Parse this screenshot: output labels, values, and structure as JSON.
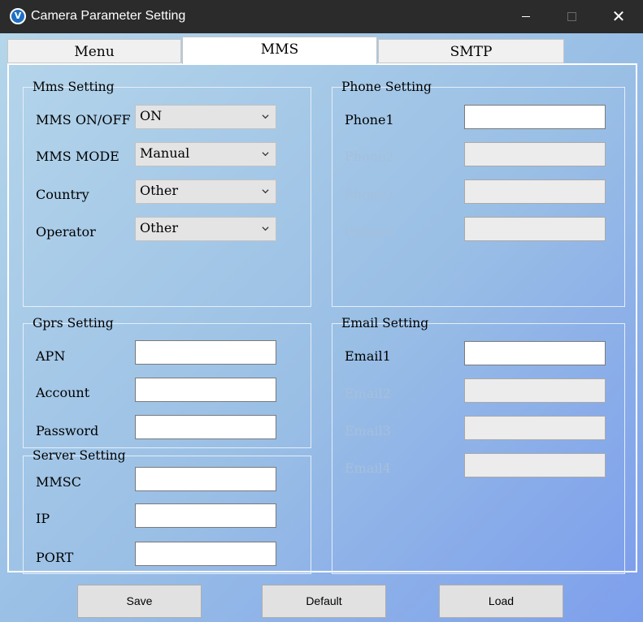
{
  "window": {
    "title": "Camera Parameter Setting",
    "icon_glyph": "V",
    "close_glyph": "✕"
  },
  "tabs": [
    {
      "label": "Menu"
    },
    {
      "label": "MMS",
      "selected": true
    },
    {
      "label": "SMTP"
    }
  ],
  "mms_setting": {
    "title": "Mms Setting",
    "fields": [
      {
        "label": "MMS ON/OFF",
        "value": "ON"
      },
      {
        "label": "MMS MODE",
        "value": "Manual"
      },
      {
        "label": "Country",
        "value": "Other"
      },
      {
        "label": "Operator",
        "value": "Other"
      }
    ]
  },
  "phone_setting": {
    "title": "Phone Setting",
    "fields": [
      {
        "label": "Phone1",
        "value": "",
        "enabled": true
      },
      {
        "label": "Phone2",
        "value": "",
        "enabled": false
      },
      {
        "label": "Phone3",
        "value": "",
        "enabled": false
      },
      {
        "label": "Phone4",
        "value": "",
        "enabled": false
      }
    ]
  },
  "gprs_setting": {
    "title": "Gprs Setting",
    "fields": [
      {
        "label": "APN",
        "value": ""
      },
      {
        "label": "Account",
        "value": ""
      },
      {
        "label": "Password",
        "value": ""
      }
    ]
  },
  "server_setting": {
    "title": "Server Setting",
    "fields": [
      {
        "label": "MMSC",
        "value": ""
      },
      {
        "label": "IP",
        "value": ""
      },
      {
        "label": "PORT",
        "value": ""
      }
    ]
  },
  "email_setting": {
    "title": "Email Setting",
    "fields": [
      {
        "label": "Email1",
        "value": "",
        "enabled": true
      },
      {
        "label": "Email2",
        "value": "",
        "enabled": false
      },
      {
        "label": "Email3",
        "value": "",
        "enabled": false
      },
      {
        "label": "Email4",
        "value": "",
        "enabled": false
      }
    ]
  },
  "buttons": {
    "save": "Save",
    "default": "Default",
    "load": "Load"
  },
  "colors": {
    "titlebar": "#2b2b2b",
    "gradient_start": "#b4d6ea",
    "gradient_end": "#7e9fec",
    "disabled_label": "#a6bfdc"
  },
  "icons": {
    "app": "camera-app-icon",
    "dropdown": "chevron-down-icon"
  }
}
